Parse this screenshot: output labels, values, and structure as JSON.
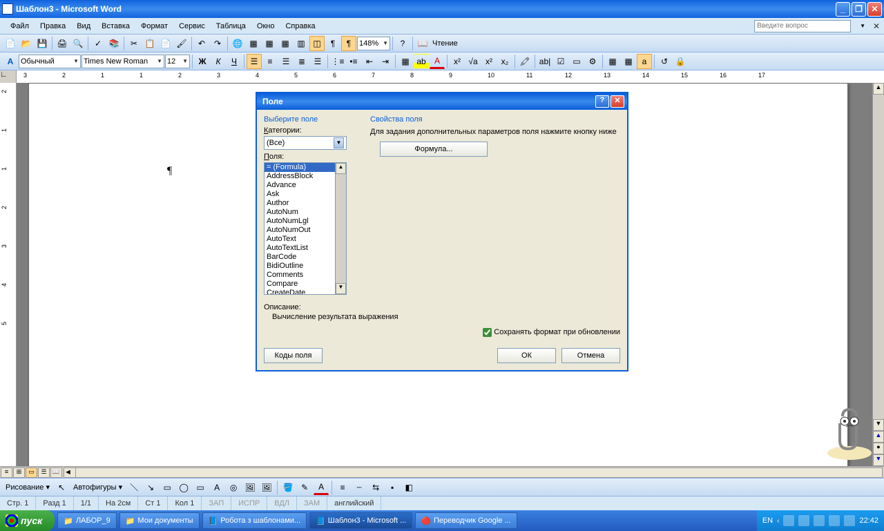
{
  "titlebar": {
    "text": "Шаблон3 - Microsoft Word"
  },
  "menu": {
    "file": "Файл",
    "edit": "Правка",
    "view": "Вид",
    "insert": "Вставка",
    "format": "Формат",
    "tools": "Сервис",
    "table": "Таблица",
    "window": "Окно",
    "help": "Справка",
    "question_placeholder": "Введите вопрос"
  },
  "formatting": {
    "style": "Обычный",
    "font": "Times New Roman",
    "size": "12",
    "zoom": "148%",
    "reading": "Чтение"
  },
  "ruler_h_marks": [
    "3",
    "2",
    "1",
    "1",
    "2",
    "3",
    "4",
    "5",
    "6",
    "7",
    "8",
    "9",
    "10",
    "11",
    "12",
    "13",
    "14",
    "15",
    "16",
    "17"
  ],
  "ruler_v_marks": [
    "2",
    "1",
    "1",
    "2",
    "3",
    "4",
    "5"
  ],
  "dialog": {
    "title": "Поле",
    "select_field": "Выберите поле",
    "categories_label": "Категории:",
    "categories_value": "(Все)",
    "fields_label": "Поля:",
    "fields": [
      "= (Formula)",
      "AddressBlock",
      "Advance",
      "Ask",
      "Author",
      "AutoNum",
      "AutoNumLgl",
      "AutoNumOut",
      "AutoText",
      "AutoTextList",
      "BarCode",
      "BidiOutline",
      "Comments",
      "Compare",
      "CreateDate"
    ],
    "selected_field_index": 0,
    "properties": "Свойства поля",
    "properties_desc": "Для задания дополнительных параметров поля нажмите кнопку ниже",
    "formula_btn": "Формула...",
    "description_label": "Описание:",
    "description_text": "Вычисление результата выражения",
    "preserve_format": "Сохранять формат при обновлении",
    "field_codes": "Коды поля",
    "ok": "ОК",
    "cancel": "Отмена"
  },
  "drawing": {
    "label": "Рисование",
    "autoshapes": "Автофигуры"
  },
  "status": {
    "page": "Стр. 1",
    "section": "Разд 1",
    "pages": "1/1",
    "at": "На 2см",
    "line": "Ст 1",
    "col": "Кол 1",
    "rec": "ЗАП",
    "fix": "ИСПР",
    "ext": "ВДЛ",
    "ovr": "ЗАМ",
    "lang": "английский"
  },
  "taskbar": {
    "start": "пуск",
    "items": [
      "ЛАБОР_9",
      "Мои документы",
      "Робота з шаблонами...",
      "Шаблон3 - Microsoft ...",
      "Переводчик Google ..."
    ],
    "active_index": 3,
    "lang": "EN",
    "time": "22:42"
  }
}
